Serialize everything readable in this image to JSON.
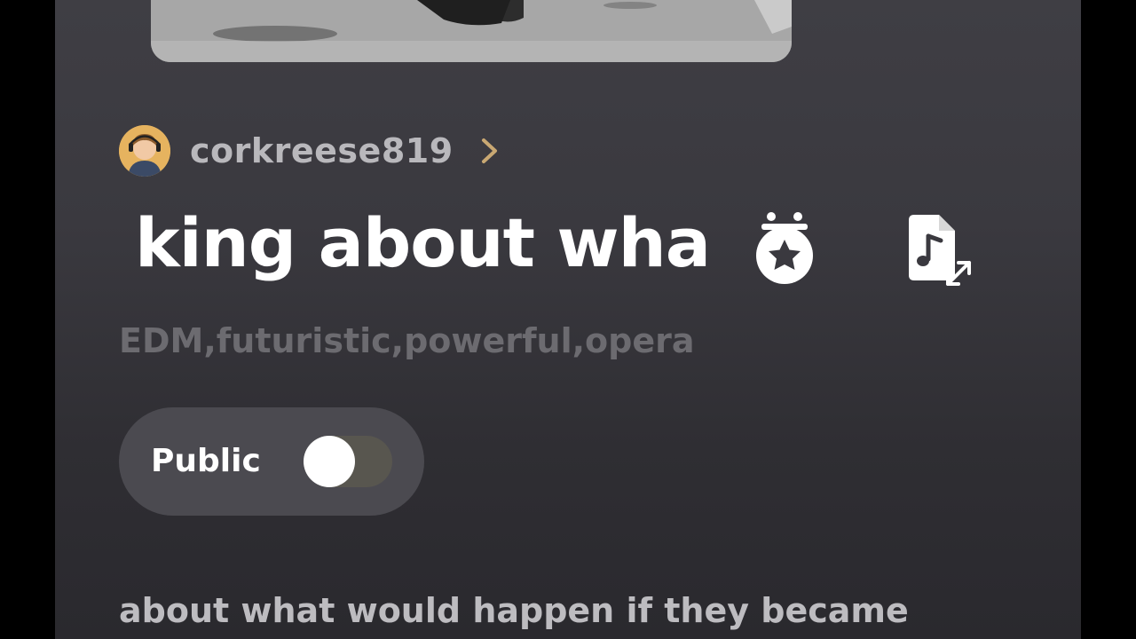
{
  "author": {
    "username": "corkreese819",
    "avatar_icon": "user-avatar",
    "chevron_icon": "chevron-right-icon",
    "chevron_color": "#c9a873"
  },
  "song": {
    "title": "king about wha",
    "tags": "EDM,futuristic,powerful,opera",
    "lyrics_line": "about what would happen if they became"
  },
  "actions": {
    "medal_icon": "medal-star-icon",
    "doc_icon": "music-file-resize-icon"
  },
  "visibility": {
    "label": "Public",
    "enabled": false
  },
  "colors": {
    "background": "#3a393f",
    "title": "#ffffff",
    "tags": "#6c6b70",
    "pill": "#4b4a50"
  }
}
